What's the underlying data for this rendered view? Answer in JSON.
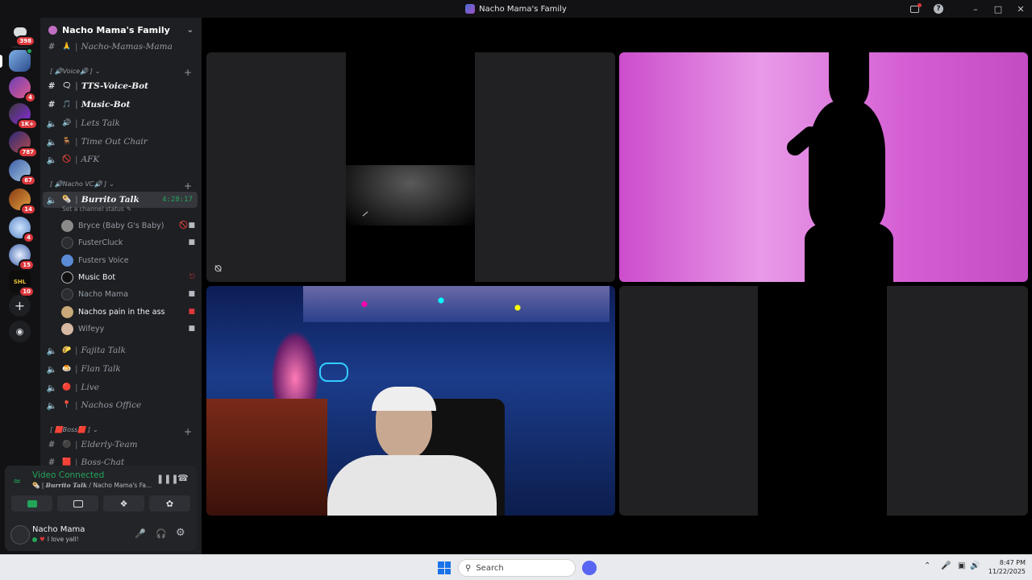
{
  "window": {
    "title": "Nacho Mama's Family",
    "controls": [
      "minimize",
      "maximize",
      "close"
    ]
  },
  "servers": {
    "home_badge": "398",
    "items": [
      {
        "name": "server-1",
        "badge": ""
      },
      {
        "name": "server-2",
        "badge": "4"
      },
      {
        "name": "server-3",
        "badge": "1K+"
      },
      {
        "name": "server-4",
        "badge": "787"
      },
      {
        "name": "server-5",
        "badge": "67"
      },
      {
        "name": "server-6",
        "badge": "14"
      },
      {
        "name": "server-7",
        "badge": "4"
      },
      {
        "name": "server-8",
        "badge": "15"
      },
      {
        "name": "server-9",
        "badge": "10"
      }
    ]
  },
  "guild": {
    "name": "Nacho Mama's Family"
  },
  "channels": {
    "top_text": "Nacho-Mamas-Mama",
    "voice_category": "[ 🔊Voice🔊 ]",
    "voice_channels": [
      {
        "name": "TTS-Voice-Bot",
        "emoji": "🗨",
        "kind": "text",
        "bold": true
      },
      {
        "name": "Music-Bot",
        "emoji": "🎵",
        "kind": "text",
        "bold": true
      },
      {
        "name": "Lets Talk",
        "emoji": "🔊",
        "kind": "voice",
        "bold": false
      },
      {
        "name": "Time Out Chair",
        "emoji": "🪑",
        "kind": "voice",
        "bold": false
      },
      {
        "name": "AFK",
        "emoji": "🚫",
        "kind": "voice",
        "bold": false
      }
    ],
    "nacho_category": "[ 🔊Nacho VC🔊 ]",
    "active_channel": {
      "name": "Burrito Talk",
      "emoji": "🌯",
      "timer": "4:28:17",
      "status_prompt": "Set a channel status"
    },
    "participants": [
      {
        "name": "Bryce (Baby G's Baby)",
        "icon": "mute-video-icon",
        "highlight": false
      },
      {
        "name": "FusterCluck",
        "icon": "video-icon",
        "highlight": false
      },
      {
        "name": "Fusters Voice",
        "icon": "",
        "highlight": false
      },
      {
        "name": "Music Bot",
        "icon": "deafened-icon",
        "highlight": true
      },
      {
        "name": "Nacho Mama",
        "icon": "video-icon",
        "highlight": false
      },
      {
        "name": "Nachos pain in the ass",
        "icon": "video-off-icon",
        "highlight": true
      },
      {
        "name": "Wifeyy",
        "icon": "video-icon",
        "highlight": false
      }
    ],
    "more_voice": [
      {
        "name": "Fajita Talk",
        "emoji": "🌮"
      },
      {
        "name": "Flan Talk",
        "emoji": "🍮"
      },
      {
        "name": "Live",
        "emoji": "🔴"
      },
      {
        "name": "Nachos Office",
        "emoji": "📍"
      }
    ],
    "boss_category": "[ 🟥Boss🟥 ]",
    "boss_channels": [
      {
        "name": "Elderly-Team",
        "emoji": "⚫"
      },
      {
        "name": "Boss-Chat",
        "emoji": "🟥"
      }
    ]
  },
  "connection": {
    "status": "Video Connected",
    "channel": "Burrito Talk",
    "server": "Nacho Mama's Fa..."
  },
  "user_panel": {
    "name": "Nacho Mama",
    "status": "I love yall!"
  },
  "taskbar": {
    "search_placeholder": "Search",
    "time": "8:47 PM",
    "date": "11/22/2025"
  },
  "colors": {
    "accent_green": "#23a55a",
    "badge_red": "#da373c",
    "sidebar_bg": "#1e1f22",
    "rail_bg": "#121214"
  }
}
